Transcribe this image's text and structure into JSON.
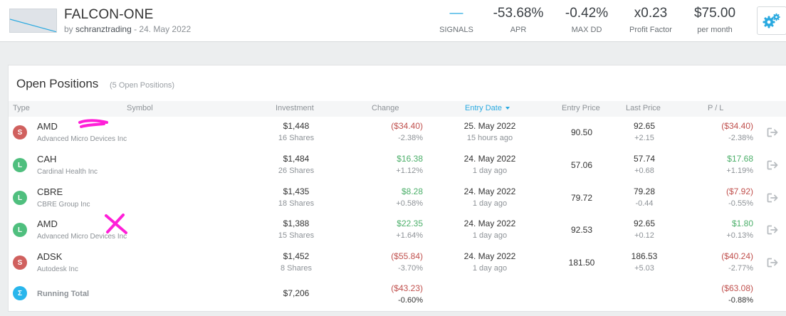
{
  "header": {
    "title": "FALCON-ONE",
    "by_prefix": "by",
    "author": "schranztrading",
    "date_sep": " - 24. May 2022",
    "stats": [
      {
        "value": "—",
        "label": "SIGNALS"
      },
      {
        "value": "-53.68%",
        "label": "APR"
      },
      {
        "value": "-0.42%",
        "label": "MAX DD"
      },
      {
        "value": "x0.23",
        "label": "Profit Factor"
      },
      {
        "value": "$75.00",
        "label": "per month"
      }
    ],
    "icon": "gears-icon"
  },
  "panel": {
    "title": "Open Positions",
    "subtitle": "(5 Open Positions)",
    "columns": {
      "type": "Type",
      "symbol": "Symbol",
      "investment": "Investment",
      "change": "Change",
      "entry_date": "Entry Date",
      "entry_price": "Entry Price",
      "last_price": "Last Price",
      "pl": "P / L"
    },
    "rows": [
      {
        "type": "S",
        "symbol": "AMD",
        "company": "Advanced Micro Devices Inc",
        "investment": "$1,448",
        "shares": "16 Shares",
        "change": "($34.40)",
        "change_pct": "-2.38%",
        "change_sign": "neg",
        "entry_date": "25. May 2022",
        "entry_ago": "15 hours ago",
        "entry_price": "90.50",
        "last_price": "92.65",
        "last_delta": "+2.15",
        "pl": "($34.40)",
        "pl_pct": "-2.38%",
        "pl_sign": "neg"
      },
      {
        "type": "L",
        "symbol": "CAH",
        "company": "Cardinal Health Inc",
        "investment": "$1,484",
        "shares": "26 Shares",
        "change": "$16.38",
        "change_pct": "+1.12%",
        "change_sign": "pos",
        "entry_date": "24. May 2022",
        "entry_ago": "1 day ago",
        "entry_price": "57.06",
        "last_price": "57.74",
        "last_delta": "+0.68",
        "pl": "$17.68",
        "pl_pct": "+1.19%",
        "pl_sign": "pos"
      },
      {
        "type": "L",
        "symbol": "CBRE",
        "company": "CBRE Group Inc",
        "investment": "$1,435",
        "shares": "18 Shares",
        "change": "$8.28",
        "change_pct": "+0.58%",
        "change_sign": "pos",
        "entry_date": "24. May 2022",
        "entry_ago": "1 day ago",
        "entry_price": "79.72",
        "last_price": "79.28",
        "last_delta": "-0.44",
        "pl": "($7.92)",
        "pl_pct": "-0.55%",
        "pl_sign": "neg"
      },
      {
        "type": "L",
        "symbol": "AMD",
        "company": "Advanced Micro Devices Inc",
        "investment": "$1,388",
        "shares": "15 Shares",
        "change": "$22.35",
        "change_pct": "+1.64%",
        "change_sign": "pos",
        "entry_date": "24. May 2022",
        "entry_ago": "1 day ago",
        "entry_price": "92.53",
        "last_price": "92.65",
        "last_delta": "+0.12",
        "pl": "$1.80",
        "pl_pct": "+0.13%",
        "pl_sign": "pos"
      },
      {
        "type": "S",
        "symbol": "ADSK",
        "company": "Autodesk Inc",
        "investment": "$1,452",
        "shares": "8 Shares",
        "change": "($55.84)",
        "change_pct": "-3.70%",
        "change_sign": "neg",
        "entry_date": "24. May 2022",
        "entry_ago": "1 day ago",
        "entry_price": "181.50",
        "last_price": "186.53",
        "last_delta": "+5.03",
        "pl": "($40.24)",
        "pl_pct": "-2.77%",
        "pl_sign": "neg"
      }
    ],
    "total": {
      "badge": "Σ",
      "label": "Running Total",
      "investment": "$7,206",
      "change": "($43.23)",
      "change_pct": "-0.60%",
      "pl": "($63.08)",
      "pl_pct": "-0.88%"
    }
  },
  "colors": {
    "accent": "#29a9e0",
    "short": "#d0605e",
    "long": "#4fbf7e",
    "negative": "#c0504d",
    "positive": "#4caf6a",
    "annotation": "#ff1fd8"
  }
}
